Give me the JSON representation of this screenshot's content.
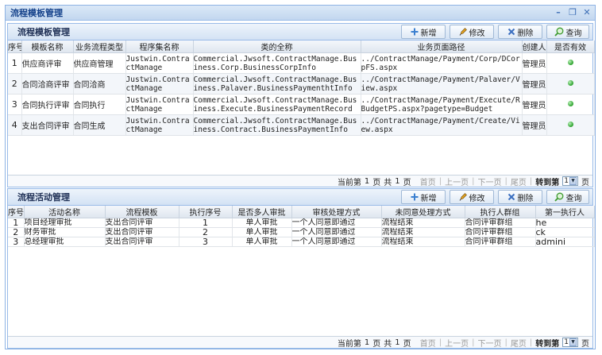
{
  "window": {
    "title": "流程模板管理"
  },
  "template_panel": {
    "title": "流程模板管理",
    "buttons": {
      "add": "新增",
      "edit": "修改",
      "delete": "删除",
      "search": "查询"
    },
    "columns": [
      "序号",
      "模板名称",
      "业务流程类型",
      "程序集名称",
      "类的全称",
      "业务页面路径",
      "创建人",
      "是否有效"
    ],
    "rows": [
      {
        "no": "1",
        "name": "供应商评审",
        "type": "供应商管理",
        "assembly": "Justwin.ContractManage",
        "cls": "Commercial.Jwsoft.ContractManage.Business.Corp.BusinessCorpInfo",
        "path": "../ContractManage/Payment/Corp/DCorpFS.aspx",
        "creator": "管理员"
      },
      {
        "no": "2",
        "name": "合同洽商评审",
        "type": "合同洽商",
        "assembly": "Justwin.ContractManage",
        "cls": "Commercial.Jwsoft.ContractManage.Business.Palaver.BusinessPaymenthtInfo",
        "path": "../ContractManage/Payment/Palaver/View.aspx",
        "creator": "管理员"
      },
      {
        "no": "3",
        "name": "合同执行评审",
        "type": "合同执行",
        "assembly": "Justwin.ContractManage",
        "cls": "Commercial.Jwsoft.ContractManage.Business.Execute.BusinessPaymentRecord",
        "path": "../ContractManage/Payment/Execute/RBudgetPS.aspx?pagetype=Budget",
        "creator": "管理员"
      },
      {
        "no": "4",
        "name": "支出合同评审",
        "type": "合同生成",
        "assembly": "Justwin.ContractManage",
        "cls": "Commercial.Jwsoft.ContractManage.Business.Contract.BusinessPaymentInfo",
        "path": "../ContractManage/Payment/Create/View.aspx",
        "creator": "管理员"
      }
    ],
    "pager": {
      "current": "当前第",
      "page_num": "1",
      "page_unit": "页",
      "total": "共",
      "total_num": "1",
      "total_unit": "页",
      "first": "首页",
      "prev": "上一页",
      "next": "下一页",
      "last": "尾页",
      "goto": "转到第",
      "goto_value": "1",
      "goto_unit": "页"
    }
  },
  "activity_panel": {
    "title": "流程活动管理",
    "buttons": {
      "add": "新增",
      "edit": "修改",
      "delete": "删除",
      "search": "查询"
    },
    "columns": [
      "序号",
      "活动名称",
      "流程模板",
      "执行序号",
      "是否多人审批",
      "审核处理方式",
      "未同意处理方式",
      "执行人群组",
      "第一执行人"
    ],
    "rows": [
      {
        "no": "1",
        "name": "项目经理审批",
        "tpl": "支出合同评审",
        "seq": "1",
        "multi": "单人审批",
        "mode": "一个人同意即通过",
        "reject": "流程结束",
        "group": "合同评审群组",
        "first": "he"
      },
      {
        "no": "2",
        "name": "财务审批",
        "tpl": "支出合同评审",
        "seq": "2",
        "multi": "单人审批",
        "mode": "一个人同意即通过",
        "reject": "流程结束",
        "group": "合同评审群组",
        "first": "ck"
      },
      {
        "no": "3",
        "name": "总经理审批",
        "tpl": "支出合同评审",
        "seq": "3",
        "multi": "单人审批",
        "mode": "一个人同意即通过",
        "reject": "流程结束",
        "group": "合同评审群组",
        "first": "admini"
      }
    ],
    "pager": {
      "current": "当前第",
      "page_num": "1",
      "page_unit": "页",
      "total": "共",
      "total_num": "1",
      "total_unit": "页",
      "first": "首页",
      "prev": "上一页",
      "next": "下一页",
      "last": "尾页",
      "goto": "转到第",
      "goto_value": "1",
      "goto_unit": "页"
    }
  },
  "icons": {
    "add": "plus-icon",
    "edit": "pencil-icon",
    "delete": "delete-icon",
    "search": "magnifier-icon",
    "valid": "green-dot-icon"
  },
  "colors": {
    "frame_border": "#8db2e3",
    "header_text": "#15428b",
    "valid_dot": "#2aa02a"
  }
}
